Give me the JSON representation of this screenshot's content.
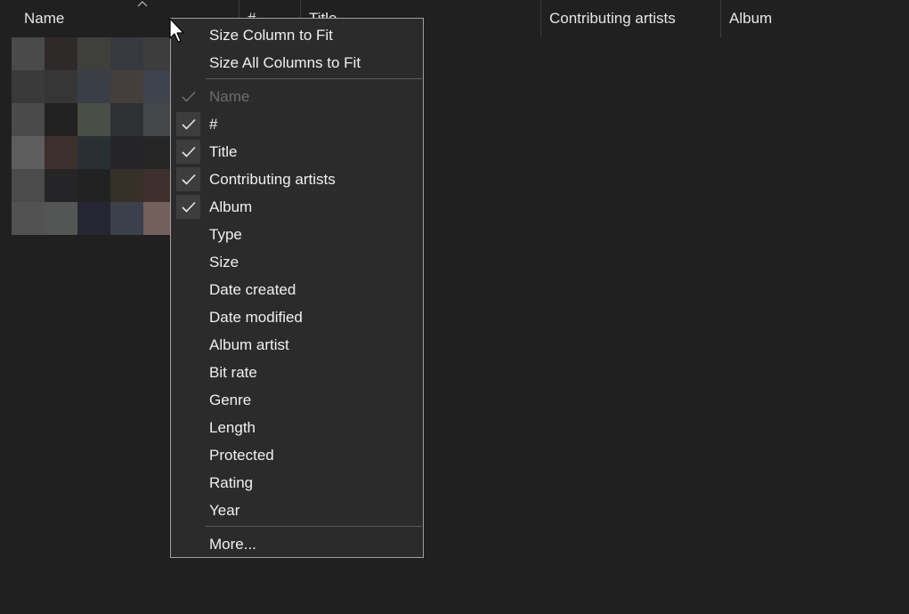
{
  "header": {
    "columns": [
      {
        "label": "Name"
      },
      {
        "label": "#"
      },
      {
        "label": "Title"
      },
      {
        "label": "Contributing artists"
      },
      {
        "label": "Album"
      }
    ],
    "sort_indicator": "chevron-up-icon"
  },
  "thumbnail": {
    "colors": [
      "#4a4a4a",
      "#2f2a2a",
      "#3f3f3b",
      "#363a3f",
      "#3d3d3d",
      "#3a3a3a",
      "#363636",
      "#3a3e46",
      "#443f3d",
      "#3e434d",
      "#4a4a4a",
      "#222222",
      "#4a4e46",
      "#2e3034",
      "#45474a",
      "#5d5d5d",
      "#3b302c",
      "#283034",
      "#252528",
      "#262626",
      "#4b4b4b",
      "#252528",
      "#222222",
      "#363028",
      "#3f302d",
      "#525252",
      "#535654",
      "#262633",
      "#3b404c",
      "#73605c"
    ]
  },
  "context_menu": {
    "actions": [
      {
        "label": "Size Column to Fit"
      },
      {
        "label": "Size All Columns to Fit"
      }
    ],
    "columns": [
      {
        "label": "Name",
        "checked": true,
        "disabled": true
      },
      {
        "label": "#",
        "checked": true,
        "disabled": false
      },
      {
        "label": "Title",
        "checked": true,
        "disabled": false
      },
      {
        "label": "Contributing artists",
        "checked": true,
        "disabled": false
      },
      {
        "label": "Album",
        "checked": true,
        "disabled": false
      },
      {
        "label": "Type",
        "checked": false,
        "disabled": false
      },
      {
        "label": "Size",
        "checked": false,
        "disabled": false
      },
      {
        "label": "Date created",
        "checked": false,
        "disabled": false
      },
      {
        "label": "Date modified",
        "checked": false,
        "disabled": false
      },
      {
        "label": "Album artist",
        "checked": false,
        "disabled": false
      },
      {
        "label": "Bit rate",
        "checked": false,
        "disabled": false
      },
      {
        "label": "Genre",
        "checked": false,
        "disabled": false
      },
      {
        "label": "Length",
        "checked": false,
        "disabled": false
      },
      {
        "label": "Protected",
        "checked": false,
        "disabled": false
      },
      {
        "label": "Rating",
        "checked": false,
        "disabled": false
      },
      {
        "label": "Year",
        "checked": false,
        "disabled": false
      }
    ],
    "more": {
      "label": "More..."
    }
  }
}
